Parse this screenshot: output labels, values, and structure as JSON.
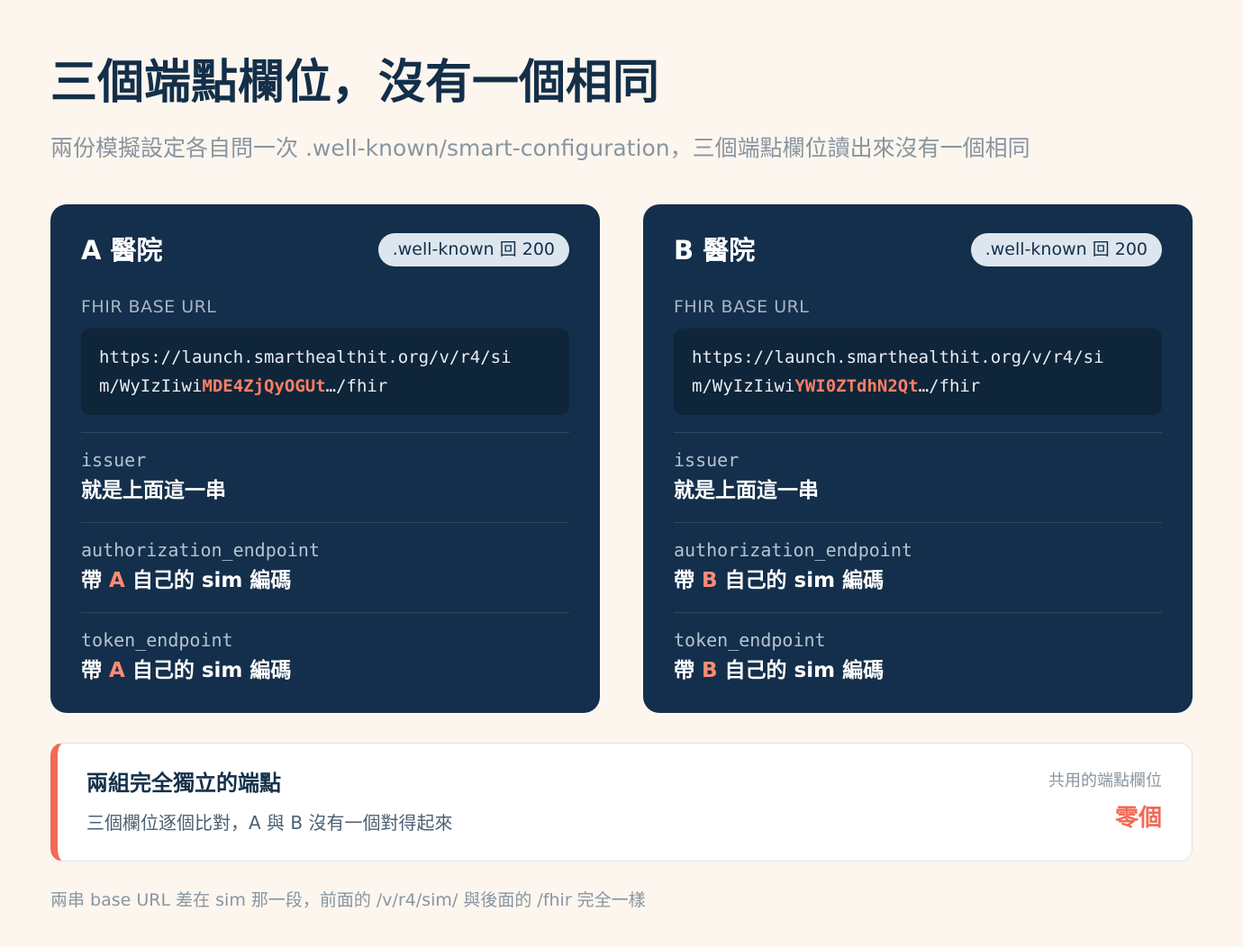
{
  "header": {
    "title": "三個端點欄位，沒有一個相同",
    "subtitle": "兩份模擬設定各自問一次 .well-known/smart-configuration，三個端點欄位讀出來沒有一個相同"
  },
  "cards": [
    {
      "title": "A 醫院",
      "status_badge": ".well-known 回 200",
      "base_url_label": "FHIR BASE URL",
      "base_url": {
        "line1": "https://launch.smarthealthit.org/v/r4/si",
        "line2_prefix": "m/WyIzIiwi",
        "line2_highlight": "MDE4ZjQyOGUt",
        "line2_suffix": "…/fhir"
      },
      "fields": [
        {
          "key": "issuer",
          "value": "就是上面這一串"
        },
        {
          "key": "authorization_endpoint",
          "value_before": "帶 ",
          "value_accent": "A",
          "value_after": " 自己的 sim 編碼"
        },
        {
          "key": "token_endpoint",
          "value_before": "帶 ",
          "value_accent": "A",
          "value_after": " 自己的 sim 編碼"
        }
      ]
    },
    {
      "title": "B 醫院",
      "status_badge": ".well-known 回 200",
      "base_url_label": "FHIR BASE URL",
      "base_url": {
        "line1": "https://launch.smarthealthit.org/v/r4/si",
        "line2_prefix": "m/WyIzIiwi",
        "line2_highlight": "YWI0ZTdhN2Qt",
        "line2_suffix": "…/fhir"
      },
      "fields": [
        {
          "key": "issuer",
          "value": "就是上面這一串"
        },
        {
          "key": "authorization_endpoint",
          "value_before": "帶 ",
          "value_accent": "B",
          "value_after": " 自己的 sim 編碼"
        },
        {
          "key": "token_endpoint",
          "value_before": "帶 ",
          "value_accent": "B",
          "value_after": " 自己的 sim 編碼"
        }
      ]
    }
  ],
  "summary": {
    "title": "兩組完全獨立的端點",
    "description": "三個欄位逐個比對，A 與 B 沒有一個對得起來",
    "side_label": "共用的端點欄位",
    "side_value": "零個"
  },
  "footnote": "兩串 base URL 差在 sim 那一段，前面的 /v/r4/sim/ 與後面的 /fhir 完全一樣",
  "colors": {
    "background": "#fcf6ef",
    "card": "#142f4b",
    "url_box": "#0f2539",
    "accent": "#f26a55",
    "highlight": "#ff7e67",
    "badge": "#dde6ee"
  }
}
